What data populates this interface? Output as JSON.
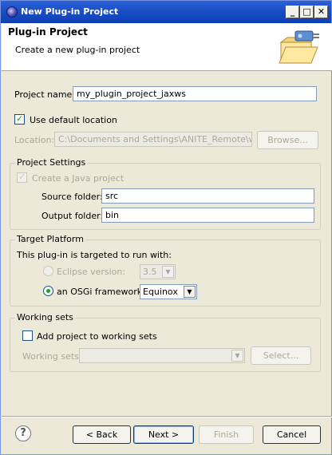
{
  "window": {
    "title": "New Plug-in Project"
  },
  "titlebar": {
    "minimize": "_",
    "maximize": "□",
    "close": "✕"
  },
  "header": {
    "title": "Plug-in Project",
    "subtitle": "Create a new plug-in project"
  },
  "project": {
    "name_label": "Project name:",
    "name_value": "my_plugin_project_jaxws",
    "use_default_location_label": "Use default location",
    "use_default_location_checked": true,
    "location_label": "Location:",
    "location_value": "C:\\Documents and Settings\\ANITE_Remote\\work",
    "browse_label": "Browse..."
  },
  "project_settings": {
    "title": "Project Settings",
    "create_java_label": "Create a Java project",
    "create_java_checked": true,
    "source_folder_label": "Source folder:",
    "source_folder_value": "src",
    "output_folder_label": "Output folder:",
    "output_folder_value": "bin"
  },
  "target_platform": {
    "title": "Target Platform",
    "description": "This plug-in is targeted to run with:",
    "eclipse_label": "Eclipse version:",
    "eclipse_value": "3.5",
    "osgi_label": "an OSGi framework:",
    "osgi_value": "Equinox",
    "selected": "osgi"
  },
  "working_sets": {
    "title": "Working sets",
    "add_label": "Add project to working sets",
    "add_checked": false,
    "sets_label": "Working sets:",
    "sets_value": "",
    "select_label": "Select..."
  },
  "footer": {
    "help": "?",
    "back": "< Back",
    "next": "Next >",
    "finish": "Finish",
    "cancel": "Cancel"
  },
  "icons": {
    "title": "eclipse-icon",
    "banner": "plugin-folder-icon",
    "help": "help-icon"
  }
}
